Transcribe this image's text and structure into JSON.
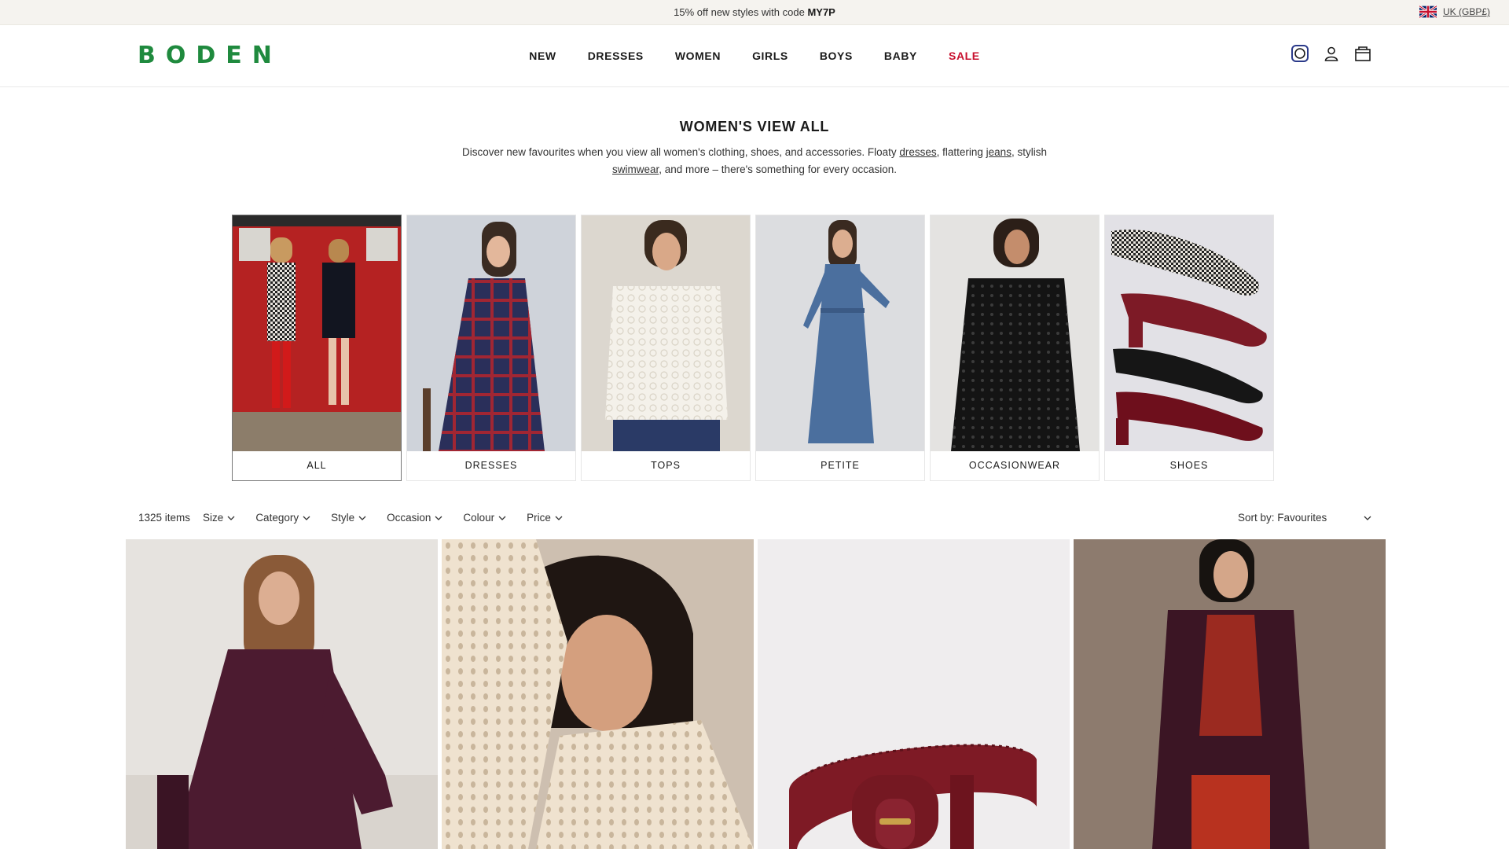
{
  "promo": {
    "text": "15% off new styles with code ",
    "code": "MY7P"
  },
  "region": {
    "label": "UK (GBP£)",
    "flag_icon": "uk-flag-icon"
  },
  "header": {
    "logo": "BODEN",
    "logo_color": "#1f8a3e",
    "nav": [
      "NEW",
      "DRESSES",
      "WOMEN",
      "GIRLS",
      "BOYS",
      "BABY",
      "SALE"
    ],
    "sale_color": "#c8102e",
    "icons": [
      "search-icon",
      "account-icon",
      "bag-icon"
    ]
  },
  "intro": {
    "title": "WOMEN'S VIEW ALL",
    "part1": "Discover new favourites when you view all women's clothing, shoes, and accessories. Floaty ",
    "link1": "dresses",
    "part2": ", flattering ",
    "link2": "jeans",
    "part3": ", stylish ",
    "link3": "swimwear",
    "part4": ", and more – there's something for every occasion."
  },
  "categories": [
    {
      "label": "ALL",
      "active": true
    },
    {
      "label": "DRESSES"
    },
    {
      "label": "TOPS"
    },
    {
      "label": "PETITE"
    },
    {
      "label": "OCCASIONWEAR"
    },
    {
      "label": "SHOES"
    }
  ],
  "filters": {
    "count": "1325 items",
    "items": [
      "Size",
      "Category",
      "Style",
      "Occasion",
      "Colour",
      "Price"
    ],
    "sort_label": "Sort by: Favourites"
  }
}
